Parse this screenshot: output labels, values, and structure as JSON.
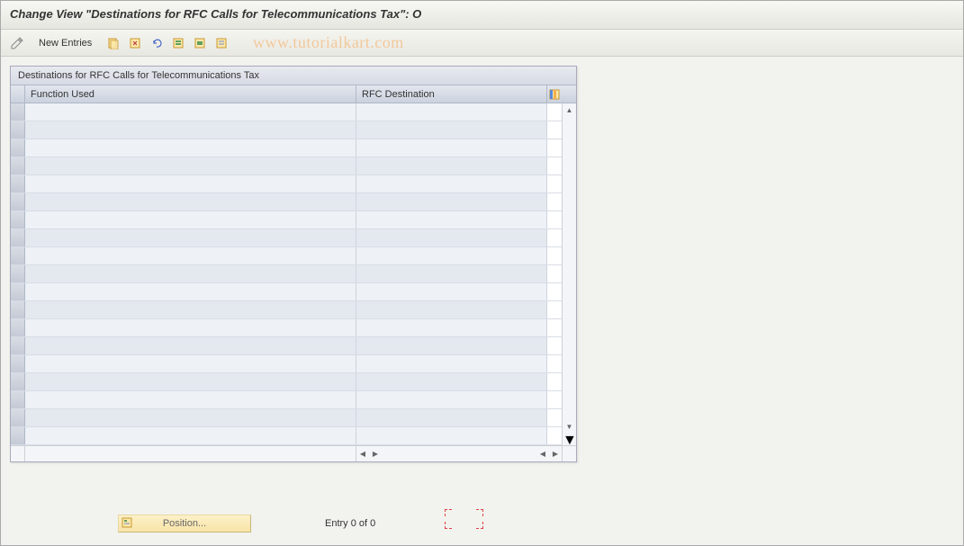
{
  "title": "Change View \"Destinations for RFC Calls for Telecommunications Tax\": O",
  "toolbar": {
    "new_entries_label": "New Entries"
  },
  "watermark": "www.tutorialkart.com",
  "table": {
    "group_title": "Destinations for RFC Calls for Telecommunications Tax",
    "columns": {
      "function_used": "Function Used",
      "rfc_destination": "RFC Destination"
    },
    "row_count": 19
  },
  "footer": {
    "position_label": "Position...",
    "entry_text": "Entry 0 of 0"
  }
}
